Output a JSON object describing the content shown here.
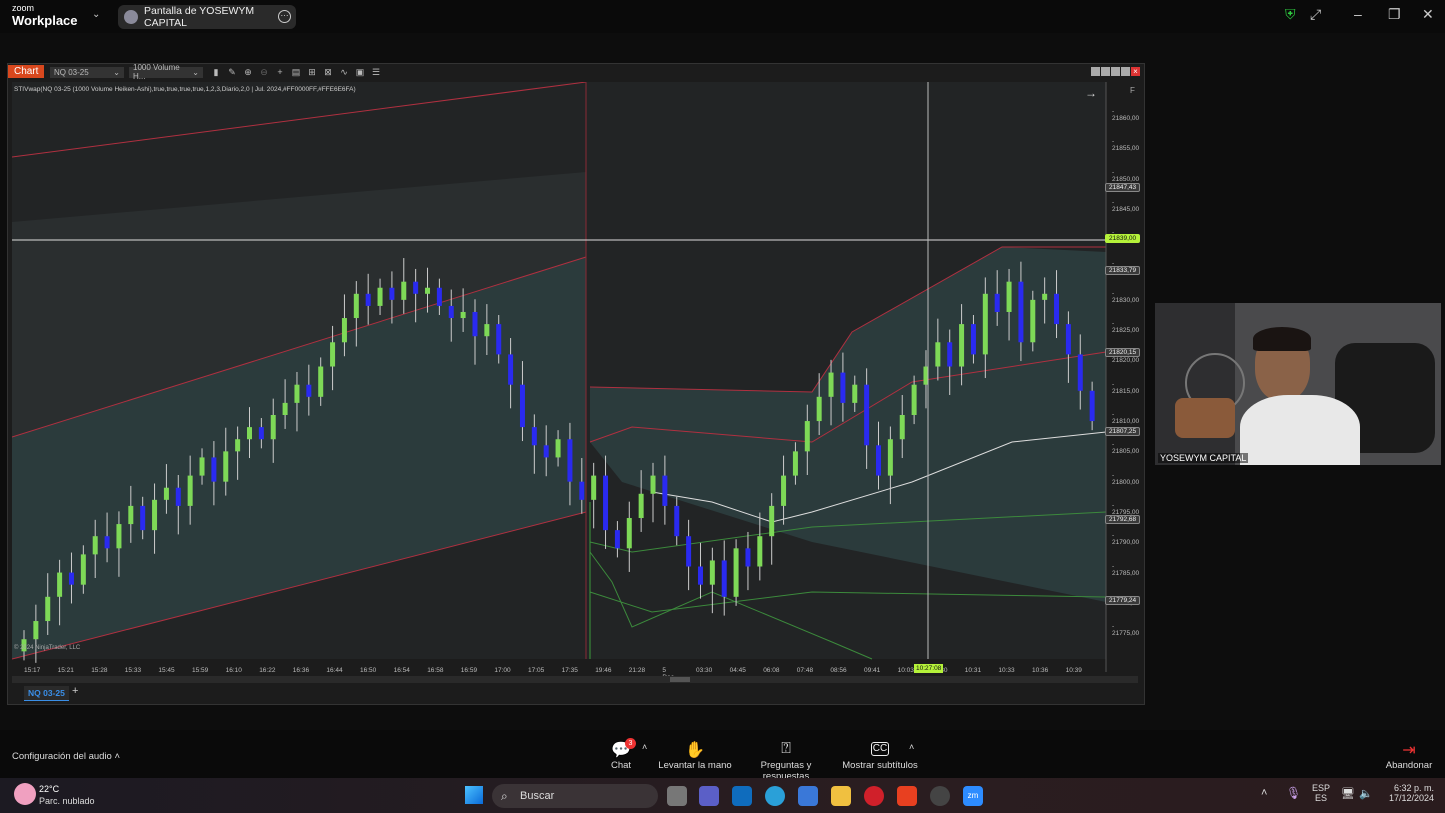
{
  "zoom": {
    "brand_small": "zoom",
    "brand_big": "Workplace",
    "share_title": "Pantalla de YOSEWYM CAPITAL",
    "toolbar": [
      {
        "icon": "chat-icon",
        "label": "Chat",
        "badge": "3"
      },
      {
        "icon": "raise-hand-icon",
        "label": "Levantar la mano"
      },
      {
        "icon": "qa-icon",
        "label": "Preguntas y respuestas"
      },
      {
        "icon": "captions-icon",
        "label": "Mostrar subtítulos"
      }
    ],
    "audio_label": "Configuración del audio",
    "leave_label": "Abandonar",
    "participant_name": "YOSEWYM CAPITAL"
  },
  "chart": {
    "tab_label": "Chart",
    "instrument": "NQ 03-25",
    "bar_type": "1000 Volume H...",
    "indicator_text": "STIVwap(NQ 03-25 (1000 Volume Heiken-Ashi),true,true,true,true,1,2,3,Diario,2,0 | Jul. 2024,#FF0000FF,#FFE6E6FA)",
    "copyright": "© 2024 NinjaTrader, LLC",
    "f_label": "F",
    "bottom_tab": "NQ 03-25",
    "price_ticks": [
      "21860,00",
      "21855,00",
      "21850,00",
      "21845,00",
      "21840,00",
      "21835,00",
      "21830,00",
      "21825,00",
      "21820,00",
      "21815,00",
      "21810,00",
      "21805,00",
      "21800,00",
      "21795,00",
      "21790,00",
      "21785,00",
      "21780,00",
      "21775,00"
    ],
    "price_markers": [
      {
        "label": "21847,43"
      },
      {
        "label": "21839,00",
        "highlight": true
      },
      {
        "label": "21833,79"
      },
      {
        "label": "21820,15"
      },
      {
        "label": "21807,25"
      },
      {
        "label": "21792,68"
      },
      {
        "label": "21779,24"
      }
    ],
    "time_labels": [
      "15:17",
      "15:21",
      "15:28",
      "15:33",
      "15:45",
      "15:59",
      "16:10",
      "16:22",
      "16:36",
      "16:44",
      "16:50",
      "16:54",
      "16:58",
      "16:59",
      "17:00",
      "17:05",
      "17:35",
      "19:46",
      "21:28",
      "5 Dec",
      "03:30",
      "04:45",
      "06:08",
      "07:48",
      "08:56",
      "09:41",
      "10:03",
      "10:30",
      "10:31",
      "10:33",
      "10:36",
      "10:39"
    ],
    "crosshair_time": "10:27:08",
    "crosshair_price": "21839,00",
    "colors": {
      "up": "#7ed957",
      "down": "#2a2af0",
      "accent": "#b5f23a",
      "band_red": "#b03040",
      "band_green": "#3c8a3c"
    },
    "closes": [
      21773,
      21776,
      21780,
      21784,
      21782,
      21787,
      21790,
      21788,
      21792,
      21795,
      21791,
      21796,
      21798,
      21795,
      21800,
      21803,
      21799,
      21804,
      21806,
      21808,
      21806,
      21810,
      21812,
      21815,
      21813,
      21818,
      21822,
      21826,
      21830,
      21828,
      21831,
      21829,
      21832,
      21830,
      21831,
      21828,
      21826,
      21827,
      21823,
      21825,
      21820,
      21815,
      21808,
      21805,
      21803,
      21806,
      21799,
      21796,
      21800,
      21791,
      21788,
      21793,
      21797,
      21800,
      21795,
      21790,
      21785,
      21782,
      21786,
      21780,
      21788,
      21785,
      21790,
      21795,
      21800,
      21804,
      21809,
      21813,
      21817,
      21812,
      21815,
      21805,
      21800,
      21806,
      21810,
      21815,
      21818,
      21822,
      21818,
      21825,
      21820,
      21830,
      21827,
      21832,
      21822,
      21829,
      21830,
      21825,
      21820,
      21814,
      21809
    ]
  },
  "taskbar": {
    "weather_temp": "22°C",
    "weather_desc": "Parc. nublado",
    "search_placeholder": "Buscar",
    "lang1": "ESP",
    "lang2": "ES",
    "time": "6:32 p. m.",
    "date": "17/12/2024"
  }
}
